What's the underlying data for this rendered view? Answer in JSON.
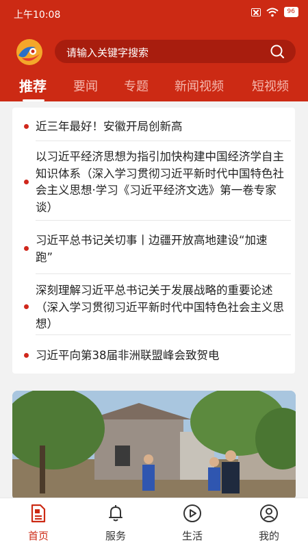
{
  "status_bar": {
    "time": "上午10:08",
    "battery": "96"
  },
  "search": {
    "placeholder": "请输入关键字搜索"
  },
  "tabs": [
    "推荐",
    "要闻",
    "专题",
    "新闻视频",
    "短视频"
  ],
  "news": [
    "近三年最好！安徽开局创新高",
    "以习近平经济思想为指引加快构建中国经济学自主知识体系（深入学习贯彻习近平新时代中国特色社会主义思想·学习《习近平经济文选》第一卷专家谈）",
    "习近平总书记关切事丨边疆开放高地建设“加速跑”",
    "深刻理解习近平总书记关于发展战略的重要论述（深入学习贯彻习近平新时代中国特色社会主义思想）",
    "习近平向第38届非洲联盟峰会致贺电"
  ],
  "bottom_nav": [
    "首页",
    "服务",
    "生活",
    "我的"
  ],
  "colors": {
    "brand_red": "#cc2a14",
    "bullet_red": "#d0271c"
  },
  "icons": [
    "logo-icon",
    "search-icon",
    "home-icon",
    "bell-icon",
    "play-circle-icon",
    "user-icon"
  ]
}
